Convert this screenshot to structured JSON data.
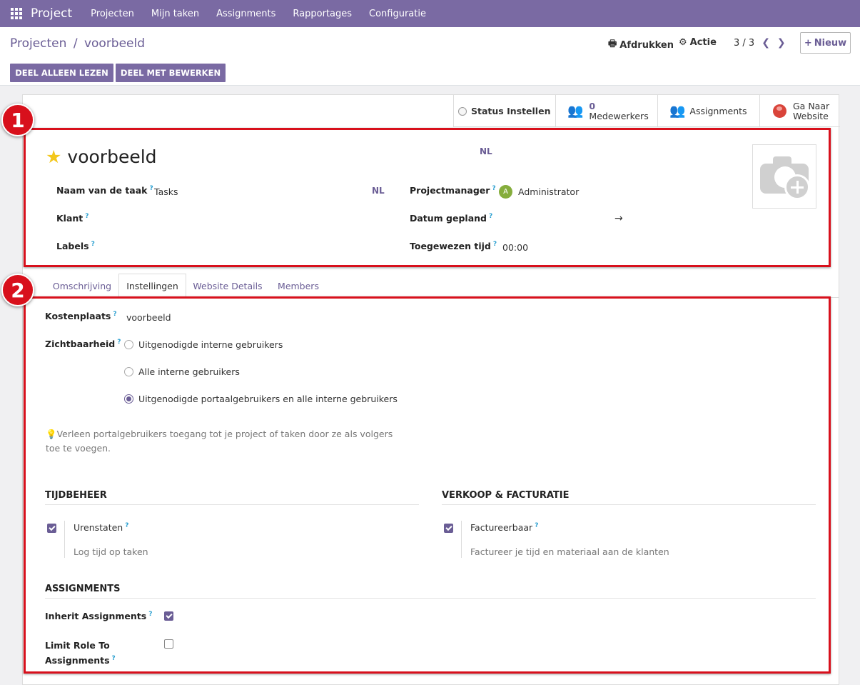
{
  "navbar": {
    "app_name": "Project",
    "menu": [
      "Projecten",
      "Mijn taken",
      "Assignments",
      "Rapportages",
      "Configuratie"
    ]
  },
  "control_panel": {
    "breadcrumb_parent": "Projecten",
    "breadcrumb_separator": "/",
    "breadcrumb_current": "voorbeeld",
    "print_label": "Afdrukken",
    "action_label": "Actie",
    "pager": "3 / 3",
    "new_label": "Nieuw",
    "share_readonly_label": "DEEL ALLEEN LEZEN",
    "share_edit_label": "DEEL MET BEWERKEN"
  },
  "smart_buttons": {
    "status_label": "Status Instellen",
    "members_count": "0",
    "members_label": "Medewerkers",
    "assignments_label": "Assignments",
    "website_line1": "Ga Naar",
    "website_line2": "Website"
  },
  "record": {
    "name": "voorbeeld",
    "lang_badge": "NL",
    "task_name_label": "Naam van de taak",
    "task_name_value": "Tasks",
    "customer_label": "Klant",
    "labels_label": "Labels",
    "manager_label": "Projectmanager",
    "manager_initial": "A",
    "manager_value": "Administrator",
    "planned_date_label": "Datum gepland",
    "planned_date_arrow": "→",
    "allocated_time_label": "Toegewezen tijd",
    "allocated_time_value": "00:00"
  },
  "tabs": [
    "Omschrijving",
    "Instellingen",
    "Website Details",
    "Members"
  ],
  "settings": {
    "cost_center_label": "Kostenplaats",
    "cost_center_value": "voorbeeld",
    "visibility_label": "Zichtbaarheid",
    "visibility_options": [
      "Uitgenodigde interne gebruikers",
      "Alle interne gebruikers",
      "Uitgenodigde portaalgebruikers en alle interne gebruikers"
    ],
    "visibility_selected_index": 2,
    "hint": "Verleen portalgebruikers toegang tot je project of taken door ze als volgers toe te voegen.",
    "time_section": "TIJDBEHEER",
    "timesheets_label": "Urenstaten",
    "timesheets_desc": "Log tijd op taken",
    "timesheets_checked": true,
    "sales_section": "VERKOOP & FACTURATIE",
    "billable_label": "Factureerbaar",
    "billable_desc": "Factureer je tijd en materiaal aan de klanten",
    "billable_checked": true,
    "assignments_section": "ASSIGNMENTS",
    "inherit_label": "Inherit Assignments",
    "inherit_checked": true,
    "limit_label_line1": "Limit Role To",
    "limit_label_line2": "Assignments",
    "limit_checked": false
  },
  "annotations": [
    "1",
    "2"
  ],
  "colors": {
    "brand": "#7a6aa3",
    "link": "#6a5d95",
    "annotation": "#d8101c",
    "star": "#f3c71c"
  }
}
